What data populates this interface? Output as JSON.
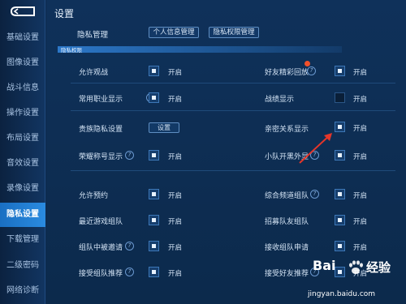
{
  "sidebar": {
    "items": [
      {
        "label": "基础设置",
        "active": false
      },
      {
        "label": "图像设置",
        "active": false
      },
      {
        "label": "战斗信息",
        "active": false
      },
      {
        "label": "操作设置",
        "active": false
      },
      {
        "label": "布局设置",
        "active": false
      },
      {
        "label": "音效设置",
        "active": false
      },
      {
        "label": "录像设置",
        "active": false
      },
      {
        "label": "隐私设置",
        "active": true
      },
      {
        "label": "下载管理",
        "active": false
      },
      {
        "label": "二级密码",
        "active": false
      },
      {
        "label": "网络诊断",
        "active": false
      }
    ]
  },
  "header": {
    "title": "设置"
  },
  "privacy": {
    "label": "隐私管理",
    "info_button": "个人信息管理",
    "permission_button": "隐私权限管理"
  },
  "section": {
    "title": "隐私权限"
  },
  "rows": {
    "allow_spectate": {
      "label": "允许观战",
      "state": "开启",
      "checked": true
    },
    "friend_highlight": {
      "label": "好友精彩回放",
      "state": "开启",
      "checked": true
    },
    "job_display": {
      "label": "常用职业显示",
      "state": "开启",
      "checked": true
    },
    "record_display": {
      "label": "战绩显示",
      "state": "开启",
      "checked": false
    },
    "noble_privacy": {
      "label": "贵族隐私设置",
      "button": "设置"
    },
    "intimate_display": {
      "label": "亲密关系显示",
      "state": "开启",
      "checked": true
    },
    "honor_title": {
      "label": "荣耀称号显示",
      "state": "开启",
      "checked": true
    },
    "team_blacklist": {
      "label": "小队开黑外显",
      "state": "开启",
      "checked": true
    },
    "allow_reservation": {
      "label": "允许预约",
      "state": "开启",
      "checked": true
    },
    "channel_team": {
      "label": "综合频道组队",
      "state": "开启",
      "checked": true
    },
    "recent_team": {
      "label": "最近游戏组队",
      "state": "开启",
      "checked": true
    },
    "recruit_team": {
      "label": "招募队友组队",
      "state": "开启",
      "checked": true
    },
    "team_invited": {
      "label": "组队中被邀请",
      "state": "开启",
      "checked": true
    },
    "team_request": {
      "label": "接收组队申请",
      "state": "开启",
      "checked": true
    },
    "accept_recommend": {
      "label": "接受组队推荐",
      "state": "开启",
      "checked": true
    },
    "friend_recommend": {
      "label": "接受好友推荐",
      "state": "开启",
      "checked": true
    }
  },
  "watermark": {
    "brand": "Bai",
    "brand2": "经验",
    "url": "jingyan.baidu.com"
  },
  "colors": {
    "accent": "#2a8be0",
    "arrow": "#e5362a",
    "badge": "#f0502a"
  }
}
